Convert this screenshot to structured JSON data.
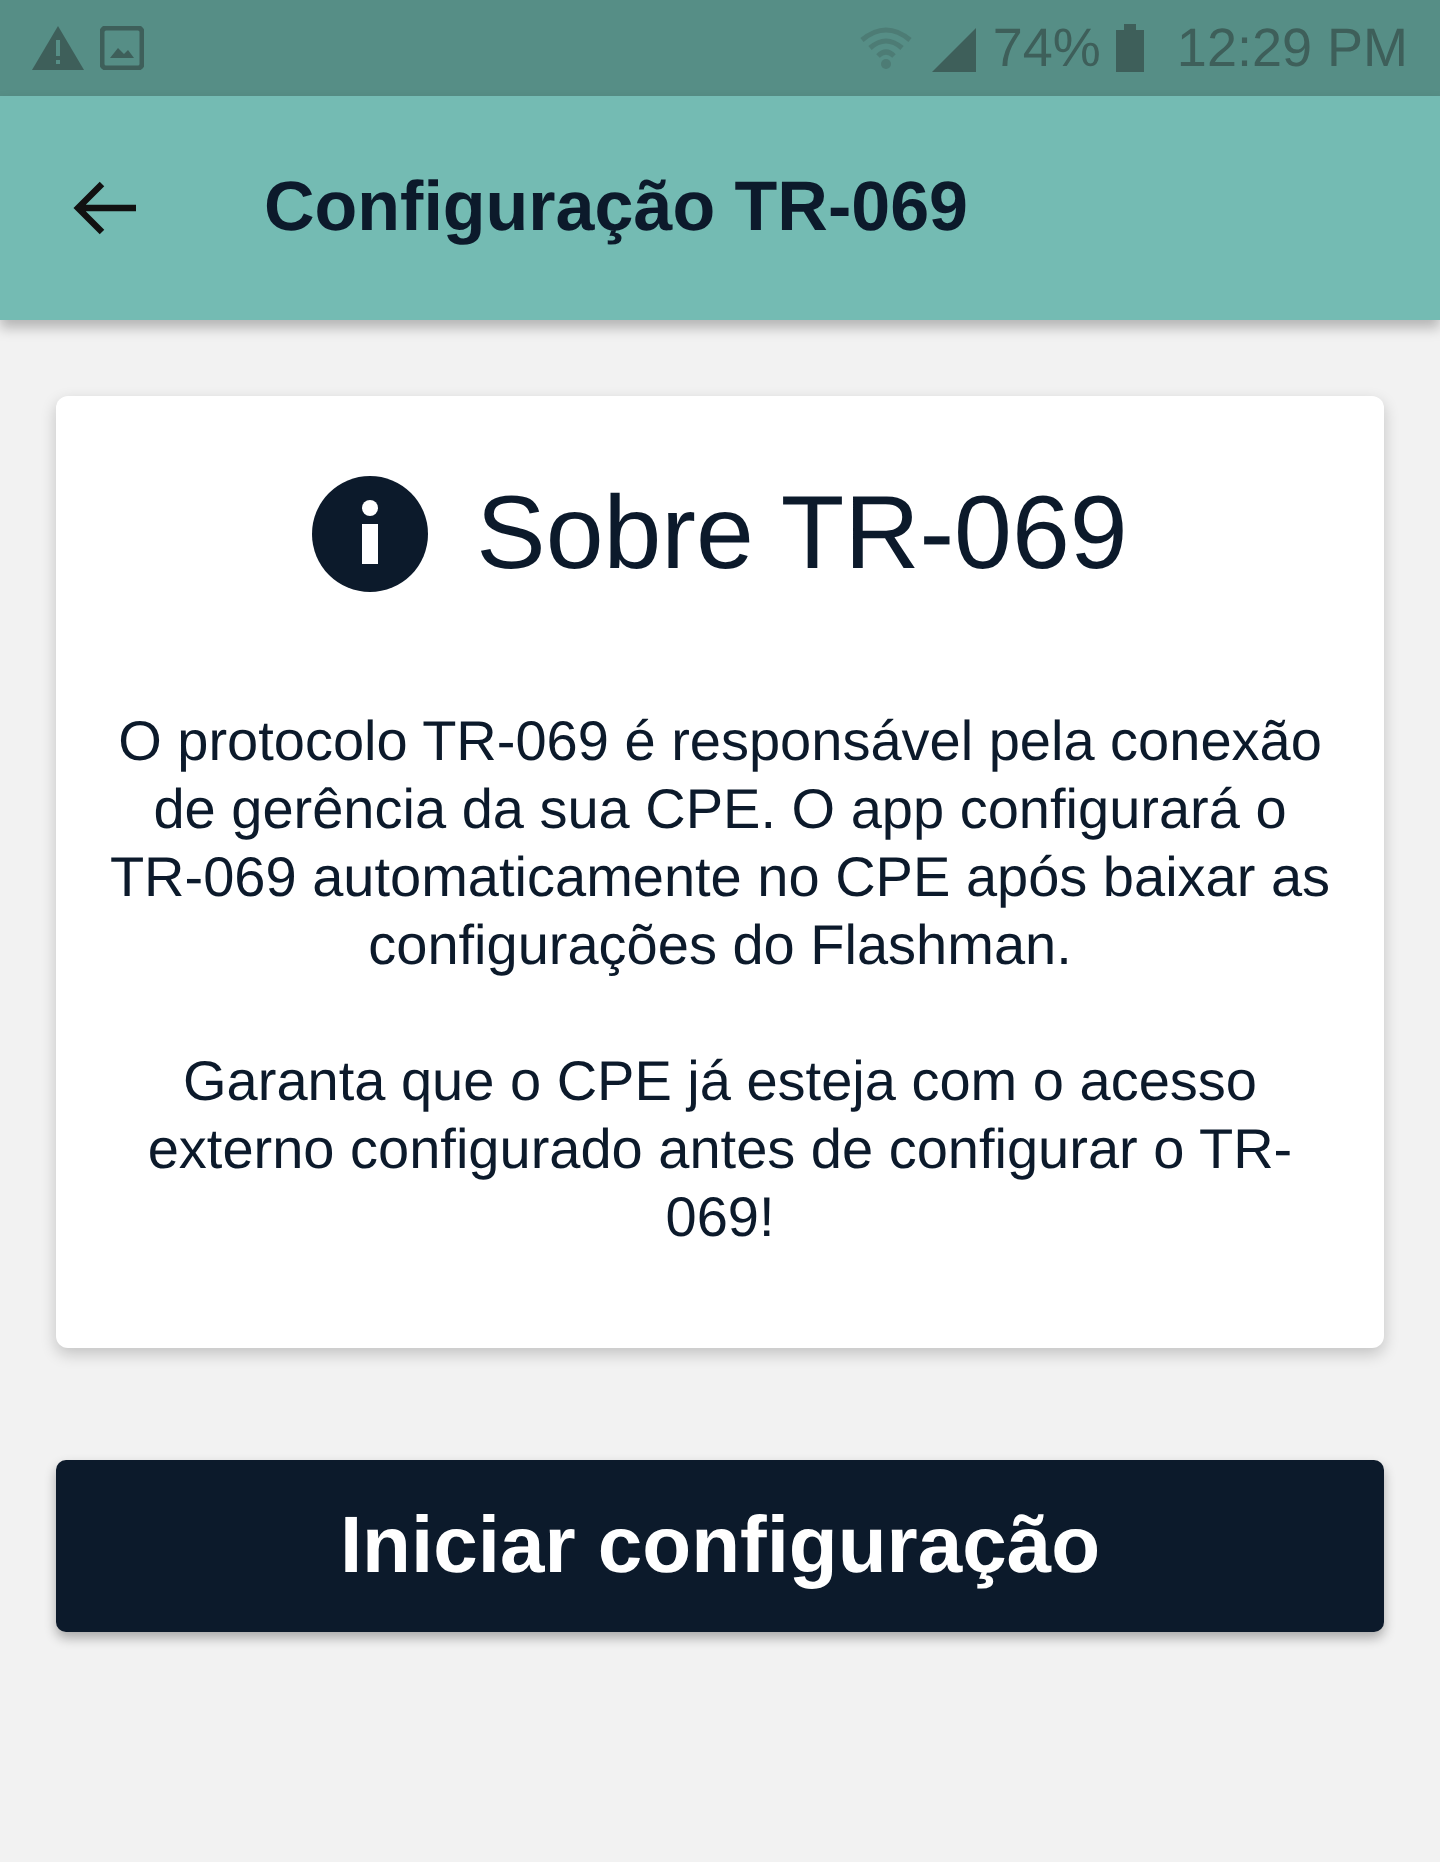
{
  "status_bar": {
    "battery": "74%",
    "time": "12:29 PM"
  },
  "app_bar": {
    "title": "Configuração TR-069"
  },
  "info_card": {
    "title": "Sobre TR-069",
    "paragraphs": [
      "O protocolo TR-069 é responsável pela conexão de gerência da sua CPE. O app configurará o TR-069 automaticamente no CPE após baixar as configurações do Flashman.",
      "Garanta que o CPE já esteja com o acesso externo configurado antes de configurar o TR-069!"
    ]
  },
  "primary_button": {
    "label": "Iniciar configuração"
  }
}
